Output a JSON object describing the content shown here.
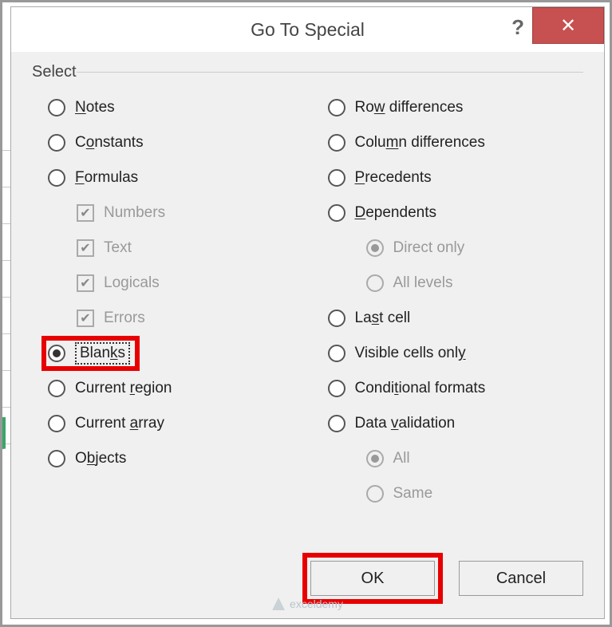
{
  "dialog": {
    "title": "Go To Special",
    "help": "?",
    "close": "✕"
  },
  "group": {
    "label": "Select"
  },
  "left": {
    "notes": "Notes",
    "constants": "Constants",
    "formulas": "Formulas",
    "numbers": "Numbers",
    "text": "Text",
    "logicals": "Logicals",
    "errors": "Errors",
    "blanks": "Blanks",
    "curregion": "Current region",
    "curarray": "Current array",
    "objects": "Objects"
  },
  "right": {
    "rowdiff": "Row differences",
    "coldiff": "Column differences",
    "precedents": "Precedents",
    "dependents": "Dependents",
    "directonly": "Direct only",
    "alllevels": "All levels",
    "lastcell": "Last cell",
    "visible": "Visible cells only",
    "condfmt": "Conditional formats",
    "dataval": "Data validation",
    "all": "All",
    "same": "Same"
  },
  "buttons": {
    "ok": "OK",
    "cancel": "Cancel"
  },
  "state": {
    "selected": "blanks",
    "formulas_children_checked": true,
    "formulas_children_enabled": false,
    "dependents_sub_enabled": false,
    "dataval_sub_enabled": false
  },
  "watermark": "exceldemy"
}
